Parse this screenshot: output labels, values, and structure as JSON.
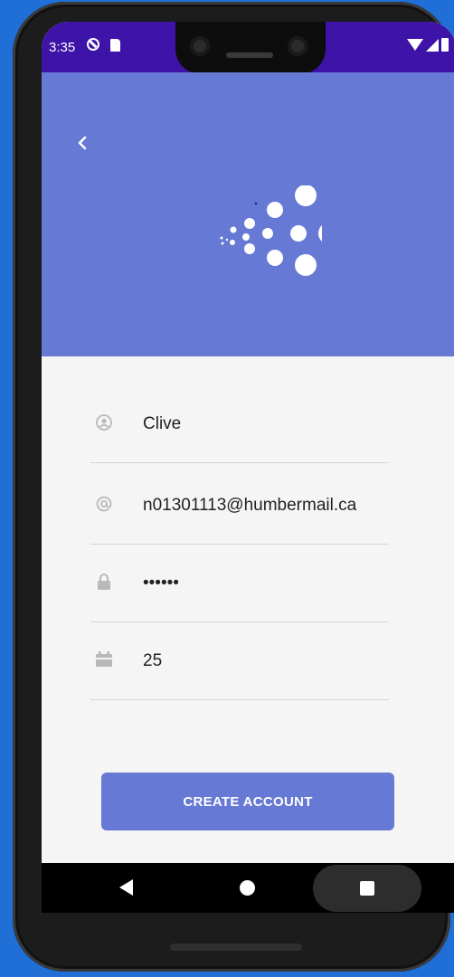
{
  "status_bar": {
    "time": "3:35"
  },
  "form": {
    "name_value": "Clive",
    "email_value": "n01301113@humbermail.ca",
    "password_value": "••••••",
    "age_value": "25"
  },
  "create_button_label": "CREATE ACCOUNT",
  "colors": {
    "status_bar": "#3d13a8",
    "header": "#6679d4",
    "button": "#6679d4",
    "form_bg": "#f5f5f5"
  },
  "icons": [
    "back-arrow-icon",
    "app-logo-icon",
    "person-icon",
    "at-sign-icon",
    "lock-icon",
    "calendar-icon",
    "wifi-icon",
    "signal-icon",
    "battery-icon"
  ]
}
